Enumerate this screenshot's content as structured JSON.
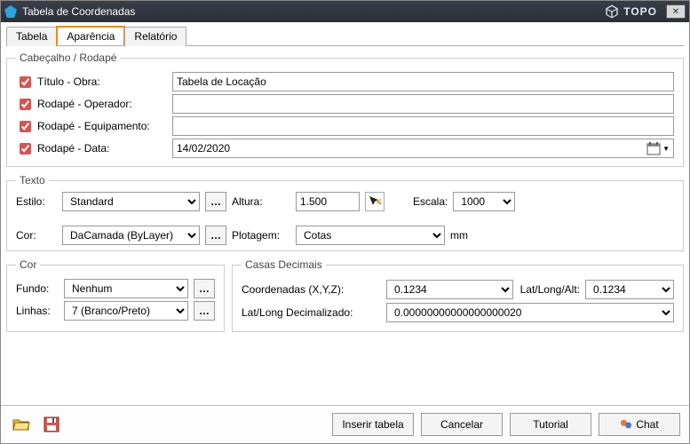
{
  "window": {
    "title": "Tabela de Coordenadas",
    "brand": "TOPO"
  },
  "tabs": {
    "t0": "Tabela",
    "t1": "Aparência",
    "t2": "Relatório",
    "active": 1
  },
  "header_footer": {
    "legend": "Cabeçalho / Rodapé",
    "title_label": "Título - Obra:",
    "title_value": "Tabela de Locação",
    "operator_label": "Rodapé  -  Operador:",
    "operator_value": "",
    "equipment_label": "Rodapé  -  Equipamento:",
    "equipment_value": "",
    "date_label": "Rodapé  -  Data:",
    "date_value": "14/02/2020"
  },
  "texto": {
    "legend": "Texto",
    "style_label": "Estilo:",
    "style_value": "Standard",
    "color_label": "Cor:",
    "color_value": "DaCamada (ByLayer)",
    "height_label": "Altura:",
    "height_value": "1.500",
    "plot_label": "Plotagem:",
    "plot_value": "Cotas",
    "plot_unit": "mm",
    "scale_label": "Escala:",
    "scale_value": "1000"
  },
  "cor": {
    "legend": "Cor",
    "bg_label": "Fundo:",
    "bg_value": "Nenhum",
    "lines_label": "Linhas:",
    "lines_value": "7 (Branco/Preto)"
  },
  "decimals": {
    "legend": "Casas Decimais",
    "coord_label": "Coordenadas (X,Y,Z):",
    "coord_value": "0.1234",
    "latlong_label": "Lat/Long/Alt:",
    "latlong_value": "0.1234",
    "dec_label": "Lat/Long Decimalizado:",
    "dec_value": "0.00000000000000000020"
  },
  "footer": {
    "insert": "Inserir tabela",
    "cancel": "Cancelar",
    "tutorial": "Tutorial",
    "chat": "Chat"
  }
}
